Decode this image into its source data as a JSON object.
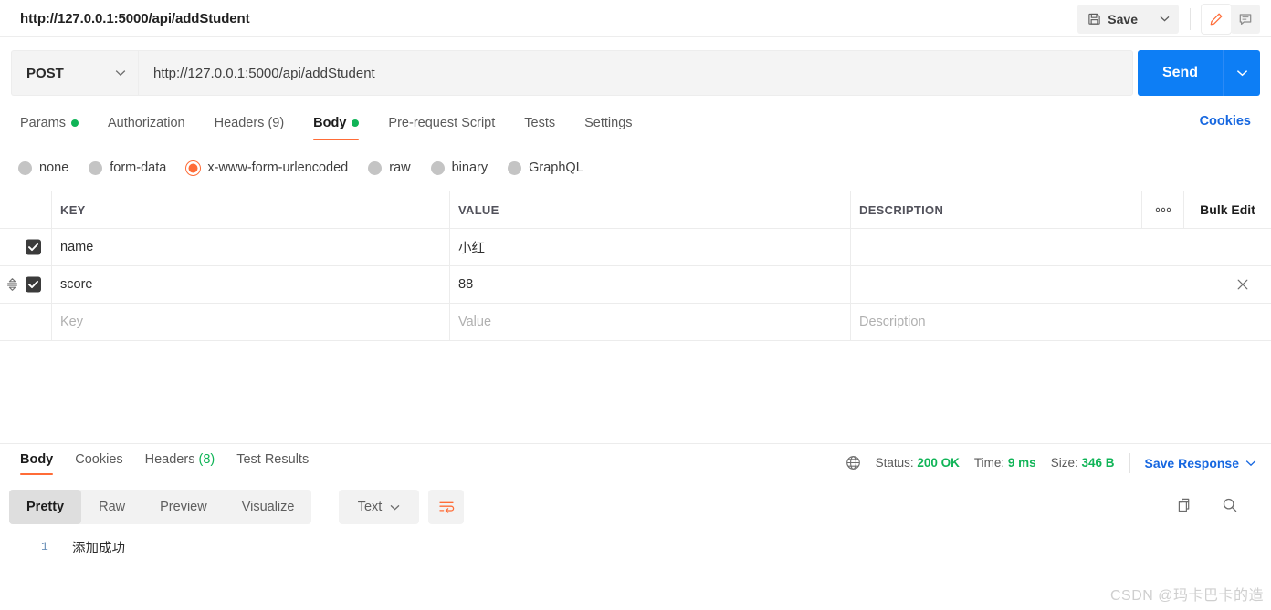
{
  "titlebar": {
    "tab_title": "http://127.0.0.1:5000/api/addStudent",
    "save_label": "Save",
    "save_icon": "floppy-disk-icon",
    "save_caret_icon": "chevron-down-icon",
    "edit_icon": "pencil-icon",
    "comment_icon": "comment-icon",
    "accent_color": "#ff6c37"
  },
  "request": {
    "method": "POST",
    "method_caret_icon": "chevron-down-icon",
    "url": "http://127.0.0.1:5000/api/addStudent",
    "send_label": "Send",
    "send_caret_icon": "chevron-down-icon",
    "send_color": "#0d7ef5"
  },
  "request_tabs": {
    "items": [
      {
        "label": "Params",
        "dot": true,
        "selected": false
      },
      {
        "label": "Authorization",
        "dot": false,
        "selected": false
      },
      {
        "label": "Headers (9)",
        "dot": false,
        "selected": false
      },
      {
        "label": "Body",
        "dot": true,
        "selected": true
      },
      {
        "label": "Pre-request Script",
        "dot": false,
        "selected": false
      },
      {
        "label": "Tests",
        "dot": false,
        "selected": false
      },
      {
        "label": "Settings",
        "dot": false,
        "selected": false
      }
    ],
    "cookies_label": "Cookies",
    "dot_color": "#10b457"
  },
  "body_types": {
    "options": [
      {
        "label": "none",
        "selected": false
      },
      {
        "label": "form-data",
        "selected": false
      },
      {
        "label": "x-www-form-urlencoded",
        "selected": true
      },
      {
        "label": "raw",
        "selected": false
      },
      {
        "label": "binary",
        "selected": false
      },
      {
        "label": "GraphQL",
        "selected": false
      }
    ]
  },
  "kv_table": {
    "headers": {
      "key": "KEY",
      "value": "VALUE",
      "description": "DESCRIPTION",
      "menu_icon": "ellipsis-icon",
      "bulk_edit": "Bulk Edit"
    },
    "rows": [
      {
        "checked": true,
        "key": "name",
        "value": "小红",
        "description": "",
        "has_drag": false,
        "has_delete": false
      },
      {
        "checked": true,
        "key": "score",
        "value": "88",
        "description": "",
        "has_drag": true,
        "has_delete": true
      }
    ],
    "placeholder_row": {
      "key": "Key",
      "value": "Value",
      "description": "Description"
    }
  },
  "response": {
    "tabs": [
      {
        "label": "Body",
        "selected": true
      },
      {
        "label": "Cookies",
        "selected": false
      },
      {
        "label": "Headers",
        "count": "(8)",
        "selected": false
      },
      {
        "label": "Test Results",
        "selected": false
      }
    ],
    "globe_icon": "globe-icon",
    "status_label": "Status:",
    "status_value": "200 OK",
    "time_label": "Time:",
    "time_value": "9 ms",
    "size_label": "Size:",
    "size_value": "346 B",
    "save_response_label": "Save Response",
    "save_response_caret_icon": "chevron-down-icon",
    "status_color": "#10b457"
  },
  "view_toolbar": {
    "segments": [
      {
        "label": "Pretty",
        "selected": true
      },
      {
        "label": "Raw",
        "selected": false
      },
      {
        "label": "Preview",
        "selected": false
      },
      {
        "label": "Visualize",
        "selected": false
      }
    ],
    "format": "Text",
    "format_caret_icon": "chevron-down-icon",
    "wrap_icon": "word-wrap-icon",
    "copy_icon": "copy-icon",
    "search_icon": "search-icon"
  },
  "response_body": {
    "line_number": "1",
    "content": "添加成功"
  },
  "watermark": "CSDN @玛卡巴卡的造"
}
